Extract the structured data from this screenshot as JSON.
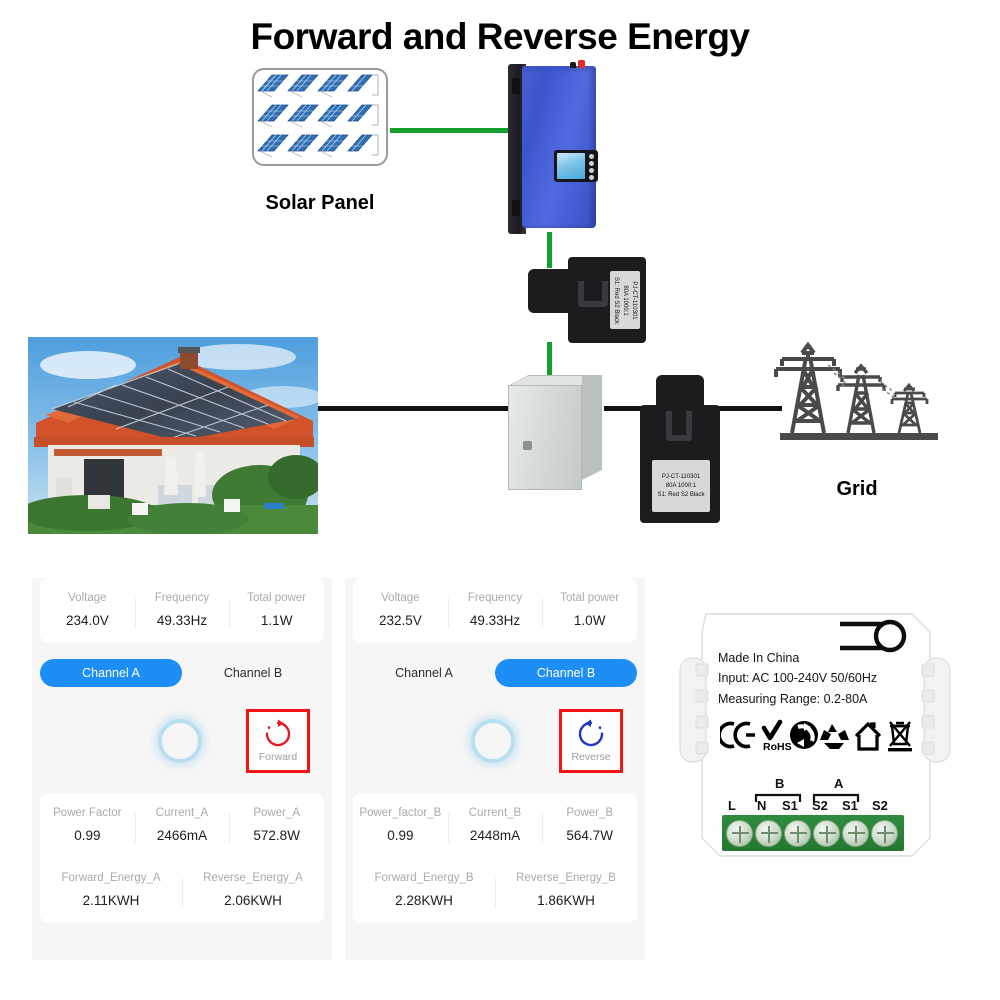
{
  "title": "Forward and Reverse Energy",
  "diagram": {
    "solar_panel_label": "Solar Panel",
    "grid_label": "Grid",
    "ct_sensor_top": {
      "model": "PJ-CT-110301",
      "rating": "80A 1000:1",
      "wiring": "S1: Red  S2 Black"
    },
    "ct_sensor_bottom": {
      "model": "PJ-CT-110301",
      "rating": "80A 1000:1",
      "wiring": "S1: Red  S2 Black"
    },
    "wire_colors": {
      "dc": "#12a02c",
      "ac": "#111111"
    }
  },
  "app_left": {
    "top_stats": [
      {
        "key": "Voltage",
        "value": "234.0V"
      },
      {
        "key": "Frequency",
        "value": "49.33Hz"
      },
      {
        "key": "Total power",
        "value": "1.1W"
      }
    ],
    "channels": [
      {
        "label": "Channel A",
        "active": true
      },
      {
        "label": "Channel B",
        "active": false
      }
    ],
    "direction": {
      "label": "Forward",
      "icon": "clockwise-arrow-icon",
      "color": "#e01b24"
    },
    "bottom_stats": [
      {
        "key": "Power Factor",
        "value": "0.99"
      },
      {
        "key": "Current_A",
        "value": "2466mA"
      },
      {
        "key": "Power_A",
        "value": "572.8W"
      }
    ],
    "energy_stats": [
      {
        "key": "Forward_Energy_A",
        "value": "2.11KWH"
      },
      {
        "key": "Reverse_Energy_A",
        "value": "2.06KWH"
      }
    ]
  },
  "app_right": {
    "top_stats": [
      {
        "key": "Voltage",
        "value": "232.5V"
      },
      {
        "key": "Frequency",
        "value": "49.33Hz"
      },
      {
        "key": "Total power",
        "value": "1.0W"
      }
    ],
    "channels": [
      {
        "label": "Channel A",
        "active": false
      },
      {
        "label": "Channel B",
        "active": true
      }
    ],
    "direction": {
      "label": "Reverse",
      "icon": "counter-clockwise-arrow-icon",
      "color": "#1f35c4"
    },
    "bottom_stats": [
      {
        "key": "Power_factor_B",
        "value": "0.99"
      },
      {
        "key": "Current_B",
        "value": "2448mA"
      },
      {
        "key": "Power_B",
        "value": "564.7W"
      }
    ],
    "energy_stats": [
      {
        "key": "Forward_Energy_B",
        "value": "2.28KWH"
      },
      {
        "key": "Reverse_Energy_B",
        "value": "1.86KWH"
      }
    ]
  },
  "module": {
    "lines": [
      "Made In China",
      "Input: AC 100-240V 50/60Hz",
      "Measuring Range: 0.2-80A"
    ],
    "cert_icons": [
      "ce-mark-icon",
      "rohs-icon",
      "green-dot-recycling-icon",
      "recycling-triangle-icon",
      "house-icon",
      "weee-crossed-bin-icon"
    ],
    "terminal_groups": [
      {
        "label": "B"
      },
      {
        "label": "A"
      }
    ],
    "terminals": [
      "L",
      "N",
      "S1",
      "S2",
      "S1",
      "S2"
    ],
    "terminal_block_color": "#2f8c3f"
  }
}
